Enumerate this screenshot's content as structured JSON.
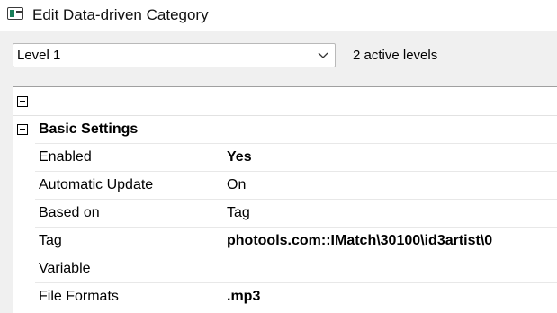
{
  "window": {
    "title": "Edit Data-driven Category"
  },
  "level": {
    "selected": "Level 1",
    "active_levels": "2 active levels"
  },
  "grid": {
    "section_label": "Basic Settings",
    "rows": [
      {
        "name": "Enabled",
        "value": "Yes"
      },
      {
        "name": "Automatic Update",
        "value": "On"
      },
      {
        "name": "Based on",
        "value": "Tag"
      },
      {
        "name": "Tag",
        "value": "photools.com::IMatch\\30100\\id3artist\\0"
      },
      {
        "name": "Variable",
        "value": ""
      },
      {
        "name": "File Formats",
        "value": ".mp3"
      }
    ]
  }
}
